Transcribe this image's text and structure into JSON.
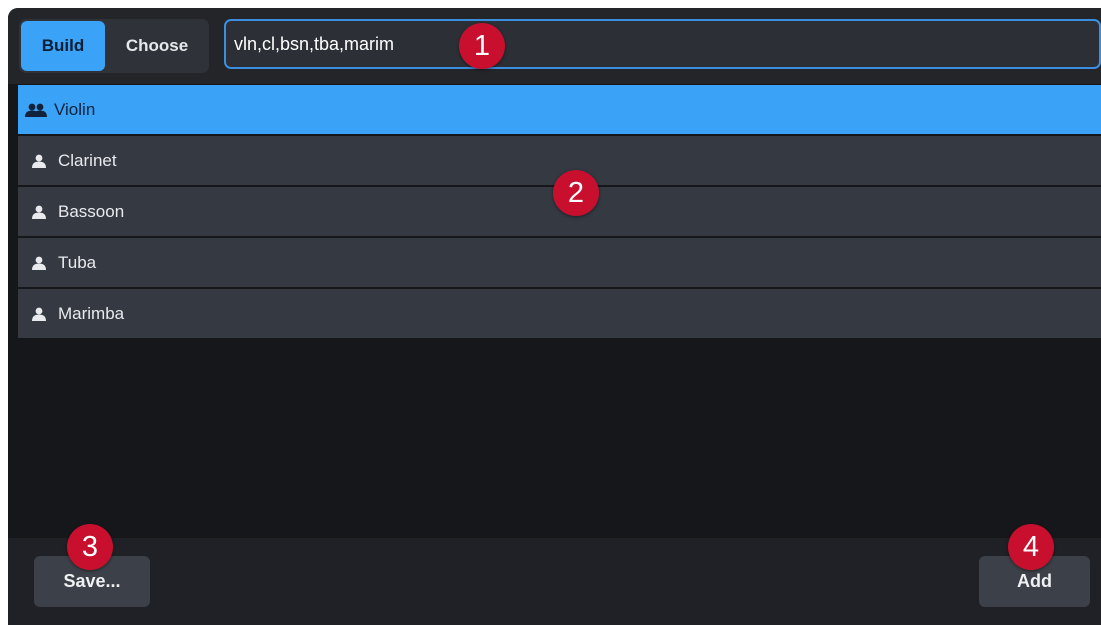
{
  "toggle": {
    "build_label": "Build",
    "choose_label": "Choose",
    "active": "Build"
  },
  "search": {
    "value": "vln,cl,bsn,tba,marim"
  },
  "instruments": [
    {
      "label": "Violin",
      "icon": "section-players-icon",
      "selected": true
    },
    {
      "label": "Clarinet",
      "icon": "single-player-icon",
      "selected": false
    },
    {
      "label": "Bassoon",
      "icon": "single-player-icon",
      "selected": false
    },
    {
      "label": "Tuba",
      "icon": "single-player-icon",
      "selected": false
    },
    {
      "label": "Marimba",
      "icon": "single-player-icon",
      "selected": false
    }
  ],
  "footer": {
    "save_label": "Save...",
    "add_label": "Add"
  },
  "callouts": [
    "1",
    "2",
    "3",
    "4"
  ],
  "colors": {
    "accent": "#3aa3f7",
    "callout": "#c8102e",
    "row": "#343942",
    "background": "#16171a"
  }
}
